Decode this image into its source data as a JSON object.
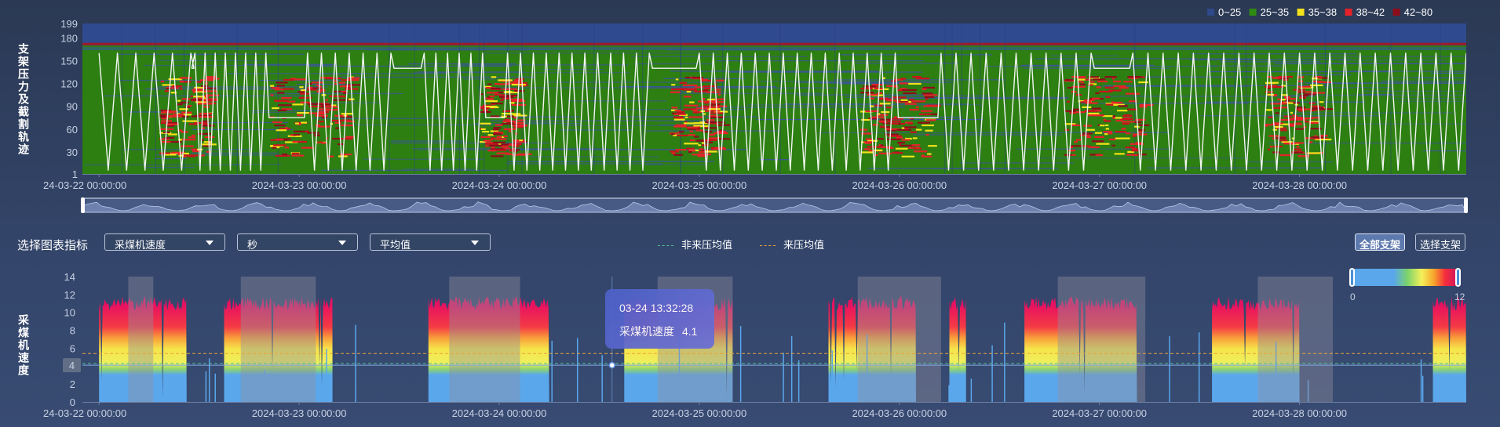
{
  "top_chart": {
    "y_title": "支架压力及截割轨迹",
    "y_ticks": [
      "199",
      "180",
      "150",
      "120",
      "90",
      "60",
      "30",
      "1"
    ],
    "x_ticks": [
      "24-03-22 00:00:00",
      "2024-03-23 00:00:00",
      "2024-03-24 00:00:00",
      "2024-03-25 00:00:00",
      "2024-03-26 00:00:00",
      "2024-03-27 00:00:00",
      "2024-03-28 00:00:00"
    ],
    "legend": [
      {
        "label": "0~25",
        "color": "#2f4a8a"
      },
      {
        "label": "25~35",
        "color": "#2e8a12"
      },
      {
        "label": "35~38",
        "color": "#f3e21a"
      },
      {
        "label": "38~42",
        "color": "#e5222a"
      },
      {
        "label": "42~80",
        "color": "#8e0d1a"
      }
    ],
    "data_zoom": {
      "start_percent": 0,
      "end_percent": 100
    }
  },
  "controls": {
    "title": "选择图表指标",
    "metric_select": "采煤机速度",
    "unit_select": "秒",
    "agg_select": "平均值",
    "legend_noncoming": "非来压均值",
    "legend_coming": "来压均值",
    "btn_all": "全部支架",
    "btn_choose": "选择支架"
  },
  "bottom_chart": {
    "y_title": "采煤机速度",
    "y_ticks": [
      "14",
      "12",
      "10",
      "8",
      "6",
      "4",
      "2",
      "0"
    ],
    "x_ticks": [
      "24-03-22 00:00:00",
      "2024-03-23 00:00:00",
      "2024-03-24 00:00:00",
      "2024-03-25 00:00:00",
      "2024-03-26 00:00:00",
      "2024-03-27 00:00:00",
      "2024-03-28 00:00:00"
    ],
    "pointer_value": "4",
    "tooltip": {
      "time": "03-24 13:32:28",
      "series": "采煤机速度",
      "value": "4.1"
    },
    "visual_map": {
      "min": "0",
      "max": "12"
    },
    "noncoming_mean": 4.3,
    "coming_mean": 5.4,
    "colors": {
      "noncoming": "#52c28c",
      "coming": "#e9a23a"
    }
  },
  "chart_data": [
    {
      "type": "heatmap",
      "ylabel": "支架压力及截割轨迹",
      "ylim": [
        1,
        199
      ],
      "x_range": [
        "2024-03-21 22:00",
        "2024-03-28 20:00"
      ],
      "categories_legend": [
        "0~25",
        "25~35",
        "35~38",
        "38~42",
        "42~80"
      ],
      "hot_zones_days": [
        [
          0.3,
          0.55
        ],
        [
          0.85,
          1.25
        ],
        [
          1.9,
          2.1
        ],
        [
          2.85,
          3.1
        ],
        [
          3.8,
          4.15
        ],
        [
          4.82,
          5.2
        ],
        [
          5.82,
          6.1
        ]
      ],
      "trajectory_cycles": [
        {
          "start": "2024-03-22 00:00",
          "end": "2024-03-22 11:00",
          "cycles": 5
        },
        {
          "start": "2024-03-22 11:30",
          "end": "2024-03-22 20:00",
          "cycles": 7
        },
        {
          "start": "2024-03-23 01:00",
          "end": "2024-03-23 11:00",
          "cycles": 6
        },
        {
          "start": "2024-03-23 15:00",
          "end": "2024-03-23 22:00",
          "cycles": 5
        },
        {
          "start": "2024-03-24 01:00",
          "end": "2024-03-24 18:00",
          "cycles": 11
        },
        {
          "start": "2024-03-25 00:00",
          "end": "2024-03-25 23:30",
          "cycles": 14
        },
        {
          "start": "2024-03-26 05:00",
          "end": "2024-03-26 23:00",
          "cycles": 10
        },
        {
          "start": "2024-03-27 04:00",
          "end": "2024-03-28 20:00",
          "cycles": 22
        }
      ]
    },
    {
      "type": "area",
      "ylabel": "采煤机速度",
      "ylim": [
        0,
        14
      ],
      "x_range": [
        "2024-03-21 22:00",
        "2024-03-28 20:00"
      ],
      "active_segments": [
        [
          "2024-03-22 00:00",
          "2024-03-22 10:30"
        ],
        [
          "2024-03-22 15:00",
          "2024-03-23 04:00"
        ],
        [
          "2024-03-23 15:30",
          "2024-03-24 06:00"
        ],
        [
          "2024-03-24 15:00",
          "2024-03-25 04:00"
        ],
        [
          "2024-03-25 15:30",
          "2024-03-26 02:00"
        ],
        [
          "2024-03-26 06:00",
          "2024-03-26 08:00"
        ],
        [
          "2024-03-26 15:00",
          "2024-03-27 04:30"
        ],
        [
          "2024-03-27 13:30",
          "2024-03-28 00:00"
        ],
        [
          "2024-03-28 16:00",
          "2024-03-28 20:00"
        ]
      ],
      "typical_peak": 11,
      "pressure_windows": [
        [
          "2024-03-22 03:30",
          "2024-03-22 06:30"
        ],
        [
          "2024-03-22 17:00",
          "2024-03-23 02:00"
        ],
        [
          "2024-03-23 18:00",
          "2024-03-24 02:30"
        ],
        [
          "2024-03-24 19:00",
          "2024-03-25 04:00"
        ],
        [
          "2024-03-25 19:00",
          "2024-03-26 05:00"
        ],
        [
          "2024-03-26 19:00",
          "2024-03-27 05:30"
        ],
        [
          "2024-03-27 19:00",
          "2024-03-28 04:00"
        ]
      ],
      "visual_map_range": [
        0,
        12
      ]
    }
  ]
}
